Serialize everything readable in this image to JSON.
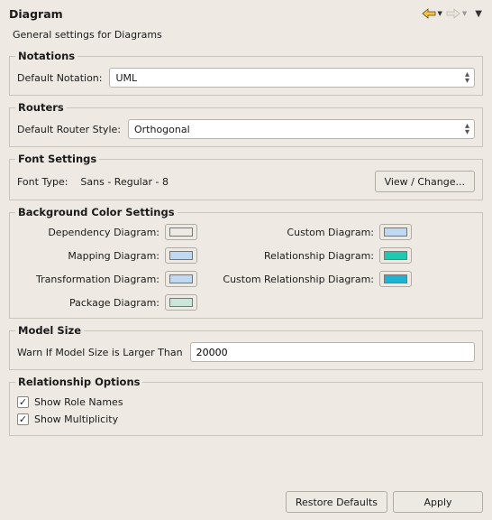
{
  "header": {
    "title": "Diagram",
    "subtitle": "General settings for Diagrams"
  },
  "notations": {
    "legend": "Notations",
    "label": "Default Notation:",
    "value": "UML"
  },
  "routers": {
    "legend": "Routers",
    "label": "Default Router Style:",
    "value": "Orthogonal"
  },
  "font": {
    "legend": "Font Settings",
    "label": "Font Type:",
    "value": "Sans - Regular - 8",
    "button": "View / Change..."
  },
  "bg": {
    "legend": "Background Color Settings",
    "items": {
      "dependency": {
        "label": "Dependency Diagram:",
        "color": "#bfd9f2"
      },
      "custom": {
        "label": "Custom Diagram:",
        "color": "#bfd9f2"
      },
      "mapping": {
        "label": "Mapping Diagram:",
        "color": "#bfd9f2"
      },
      "relationship": {
        "label": "Relationship Diagram:",
        "color": "#1fc9b0"
      },
      "transformation": {
        "label": "Transformation Diagram:",
        "color": "#bfd9f2"
      },
      "custom_relationship": {
        "label": "Custom Relationship Diagram:",
        "color": "#1fb3d1"
      },
      "package": {
        "label": "Package Diagram:",
        "color": "#c9e6d9"
      }
    }
  },
  "model_size": {
    "legend": "Model Size",
    "label": "Warn If Model Size is Larger Than",
    "value": "20000"
  },
  "rel_opts": {
    "legend": "Relationship Options",
    "show_role": "Show Role Names",
    "show_mult": "Show Multiplicity"
  },
  "footer": {
    "restore": "Restore Defaults",
    "apply": "Apply"
  }
}
